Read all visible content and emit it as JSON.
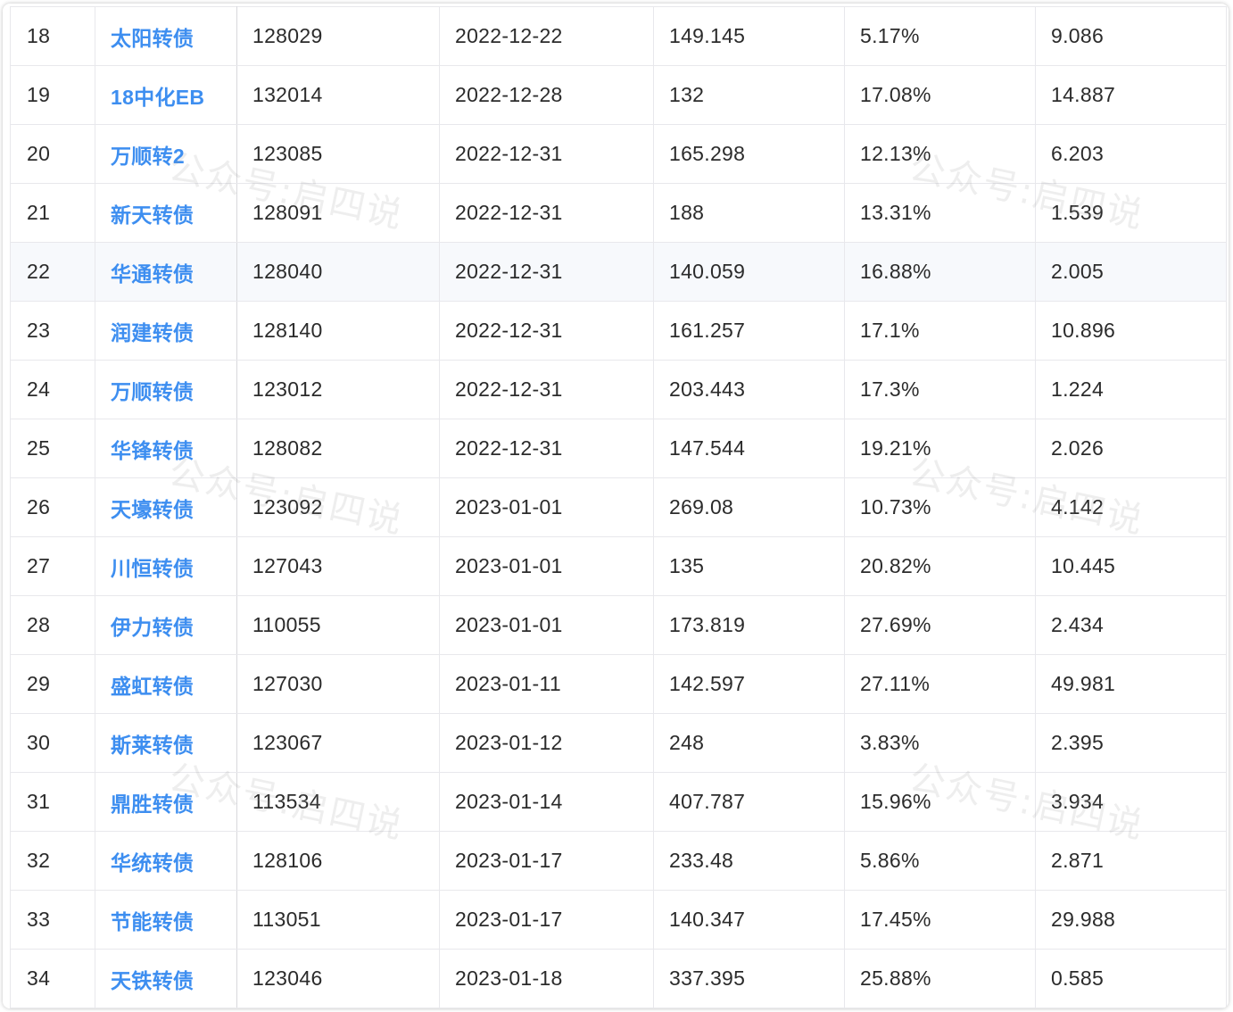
{
  "columns": [
    "index",
    "name",
    "code",
    "date",
    "price",
    "rate",
    "ratio"
  ],
  "rows": [
    {
      "index": "18",
      "name": "太阳转债",
      "code": "128029",
      "date": "2022-12-22",
      "price": "149.145",
      "rate": "5.17%",
      "ratio": "9.086"
    },
    {
      "index": "19",
      "name": "18中化EB",
      "code": "132014",
      "date": "2022-12-28",
      "price": "132",
      "rate": "17.08%",
      "ratio": "14.887"
    },
    {
      "index": "20",
      "name": "万顺转2",
      "code": "123085",
      "date": "2022-12-31",
      "price": "165.298",
      "rate": "12.13%",
      "ratio": "6.203"
    },
    {
      "index": "21",
      "name": "新天转债",
      "code": "128091",
      "date": "2022-12-31",
      "price": "188",
      "rate": "13.31%",
      "ratio": "1.539"
    },
    {
      "index": "22",
      "name": "华通转债",
      "code": "128040",
      "date": "2022-12-31",
      "price": "140.059",
      "rate": "16.88%",
      "ratio": "2.005"
    },
    {
      "index": "23",
      "name": "润建转债",
      "code": "128140",
      "date": "2022-12-31",
      "price": "161.257",
      "rate": "17.1%",
      "ratio": "10.896"
    },
    {
      "index": "24",
      "name": "万顺转债",
      "code": "123012",
      "date": "2022-12-31",
      "price": "203.443",
      "rate": "17.3%",
      "ratio": "1.224"
    },
    {
      "index": "25",
      "name": "华锋转债",
      "code": "128082",
      "date": "2022-12-31",
      "price": "147.544",
      "rate": "19.21%",
      "ratio": "2.026"
    },
    {
      "index": "26",
      "name": "天壕转债",
      "code": "123092",
      "date": "2023-01-01",
      "price": "269.08",
      "rate": "10.73%",
      "ratio": "4.142"
    },
    {
      "index": "27",
      "name": "川恒转债",
      "code": "127043",
      "date": "2023-01-01",
      "price": "135",
      "rate": "20.82%",
      "ratio": "10.445"
    },
    {
      "index": "28",
      "name": "伊力转债",
      "code": "110055",
      "date": "2023-01-01",
      "price": "173.819",
      "rate": "27.69%",
      "ratio": "2.434"
    },
    {
      "index": "29",
      "name": "盛虹转债",
      "code": "127030",
      "date": "2023-01-11",
      "price": "142.597",
      "rate": "27.11%",
      "ratio": "49.981"
    },
    {
      "index": "30",
      "name": "斯莱转债",
      "code": "123067",
      "date": "2023-01-12",
      "price": "248",
      "rate": "3.83%",
      "ratio": "2.395"
    },
    {
      "index": "31",
      "name": "鼎胜转债",
      "code": "113534",
      "date": "2023-01-14",
      "price": "407.787",
      "rate": "15.96%",
      "ratio": "3.934"
    },
    {
      "index": "32",
      "name": "华统转债",
      "code": "128106",
      "date": "2023-01-17",
      "price": "233.48",
      "rate": "5.86%",
      "ratio": "2.871"
    },
    {
      "index": "33",
      "name": "节能转债",
      "code": "113051",
      "date": "2023-01-17",
      "price": "140.347",
      "rate": "17.45%",
      "ratio": "29.988"
    },
    {
      "index": "34",
      "name": "天铁转债",
      "code": "123046",
      "date": "2023-01-18",
      "price": "337.395",
      "rate": "25.88%",
      "ratio": "0.585"
    }
  ],
  "highlighted_row": 4,
  "watermark": "公众号:启四说",
  "colors": {
    "link": "#3d8ef0",
    "text": "#2b2b2b",
    "border": "#e8e8ec",
    "highlight_row": "#f7f9fc"
  }
}
